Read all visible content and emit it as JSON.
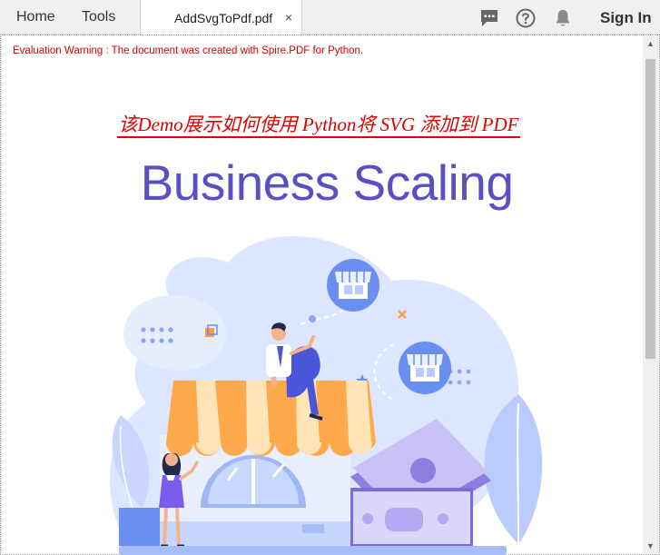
{
  "topbar": {
    "home_label": "Home",
    "tools_label": "Tools",
    "tab_title": "AddSvgToPdf.pdf",
    "close_glyph": "×",
    "icons": [
      "comment-icon",
      "help-icon",
      "bell-icon"
    ],
    "signin_label": "Sign In"
  },
  "document": {
    "evaluation_warning": "Evaluation Warning : The document was created with Spire.PDF for Python.",
    "demo_title": "该Demo展示如何使用 Python将 SVG 添加到 PDF",
    "svg_title": "Business Scaling"
  },
  "colors": {
    "warning": "#d40000",
    "demo_title": "#e00000",
    "svg_title": "#5b4fc4",
    "awning_orange": "#ffa94d",
    "awning_cream": "#ffe4b8",
    "blob_light": "#dde6ff",
    "icon_blue": "#6b8ff0"
  }
}
